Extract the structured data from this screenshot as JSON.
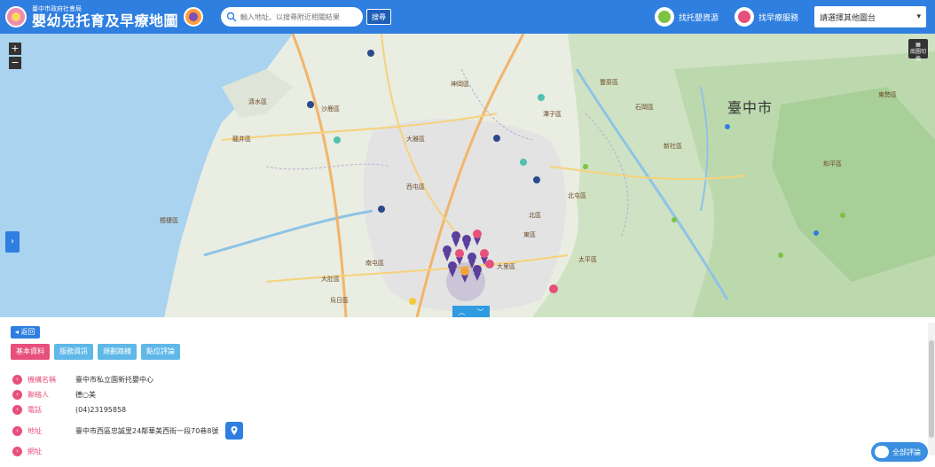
{
  "header": {
    "brand_sub": "臺中市政府社會局",
    "brand_title": "嬰幼兒托育及早療地圖",
    "search_placeholder": "輸入地址、以搜尋附近相關結果",
    "search_button": "搜尋",
    "link_childcare": "找托嬰資源",
    "link_early": "找早療服務",
    "region_select": "請選擇其他圖台"
  },
  "map": {
    "city": "臺中市",
    "layer_button": "底圖切換",
    "labels": [
      {
        "text": "清水區"
      },
      {
        "text": "沙鹿區"
      },
      {
        "text": "神岡區"
      },
      {
        "text": "潭子區"
      },
      {
        "text": "大雅區"
      },
      {
        "text": "西屯區"
      },
      {
        "text": "北屯區"
      },
      {
        "text": "龍井區"
      },
      {
        "text": "大肚區"
      },
      {
        "text": "南屯區"
      },
      {
        "text": "大里區"
      },
      {
        "text": "太平區"
      },
      {
        "text": "豐原區"
      },
      {
        "text": "東勢區"
      },
      {
        "text": "石岡區"
      },
      {
        "text": "新社區"
      },
      {
        "text": "和平區"
      },
      {
        "text": "烏日區"
      },
      {
        "text": "梧棲區"
      },
      {
        "text": "北區"
      },
      {
        "text": "東區"
      }
    ]
  },
  "panel": {
    "back": "◂ 返回",
    "tabs": [
      "基本資料",
      "服務資訊",
      "規劃路線",
      "點位評論"
    ],
    "rows": [
      {
        "label": "機構名稱",
        "value": "臺中市私立園新托嬰中心"
      },
      {
        "label": "聯絡人",
        "value": "德○美"
      },
      {
        "label": "電話",
        "value": "(04)23195858"
      },
      {
        "label": "地址",
        "value": "臺中市西區忠誠里24鄰華美西街一段70巷8號"
      },
      {
        "label": "網址",
        "value": ""
      }
    ],
    "all_comments": "全部評論"
  },
  "colors": {
    "header": "#2f7fe0",
    "accent_pink": "#e7507a",
    "tab_blue": "#5fb8e8"
  }
}
